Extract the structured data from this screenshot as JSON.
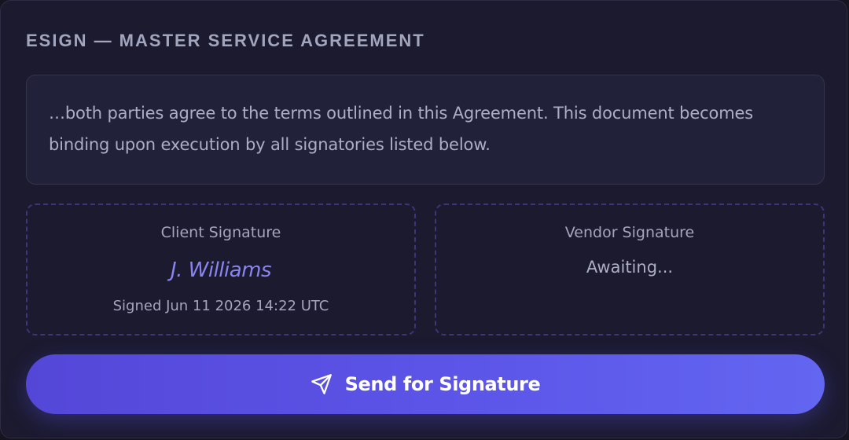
{
  "card": {
    "title": "ESIGN — MASTER SERVICE AGREEMENT"
  },
  "document": {
    "excerpt_line1": "…both parties agree to the terms outlined in this Agreement. This document becomes",
    "excerpt_line2": "binding upon execution by all signatories listed below."
  },
  "signatures": {
    "client": {
      "label": "Client Signature",
      "name": "J. Williams",
      "signed_at": "Signed Jun 11 2026 14:22 UTC"
    },
    "vendor": {
      "label": "Vendor Signature",
      "status": "Awaiting..."
    }
  },
  "actions": {
    "send_label": "Send for Signature",
    "send_icon": "send-icon"
  },
  "colors": {
    "accent": "#5c55e8",
    "signature_ink": "#8a84f0",
    "card_background": "#1b1a2f"
  }
}
